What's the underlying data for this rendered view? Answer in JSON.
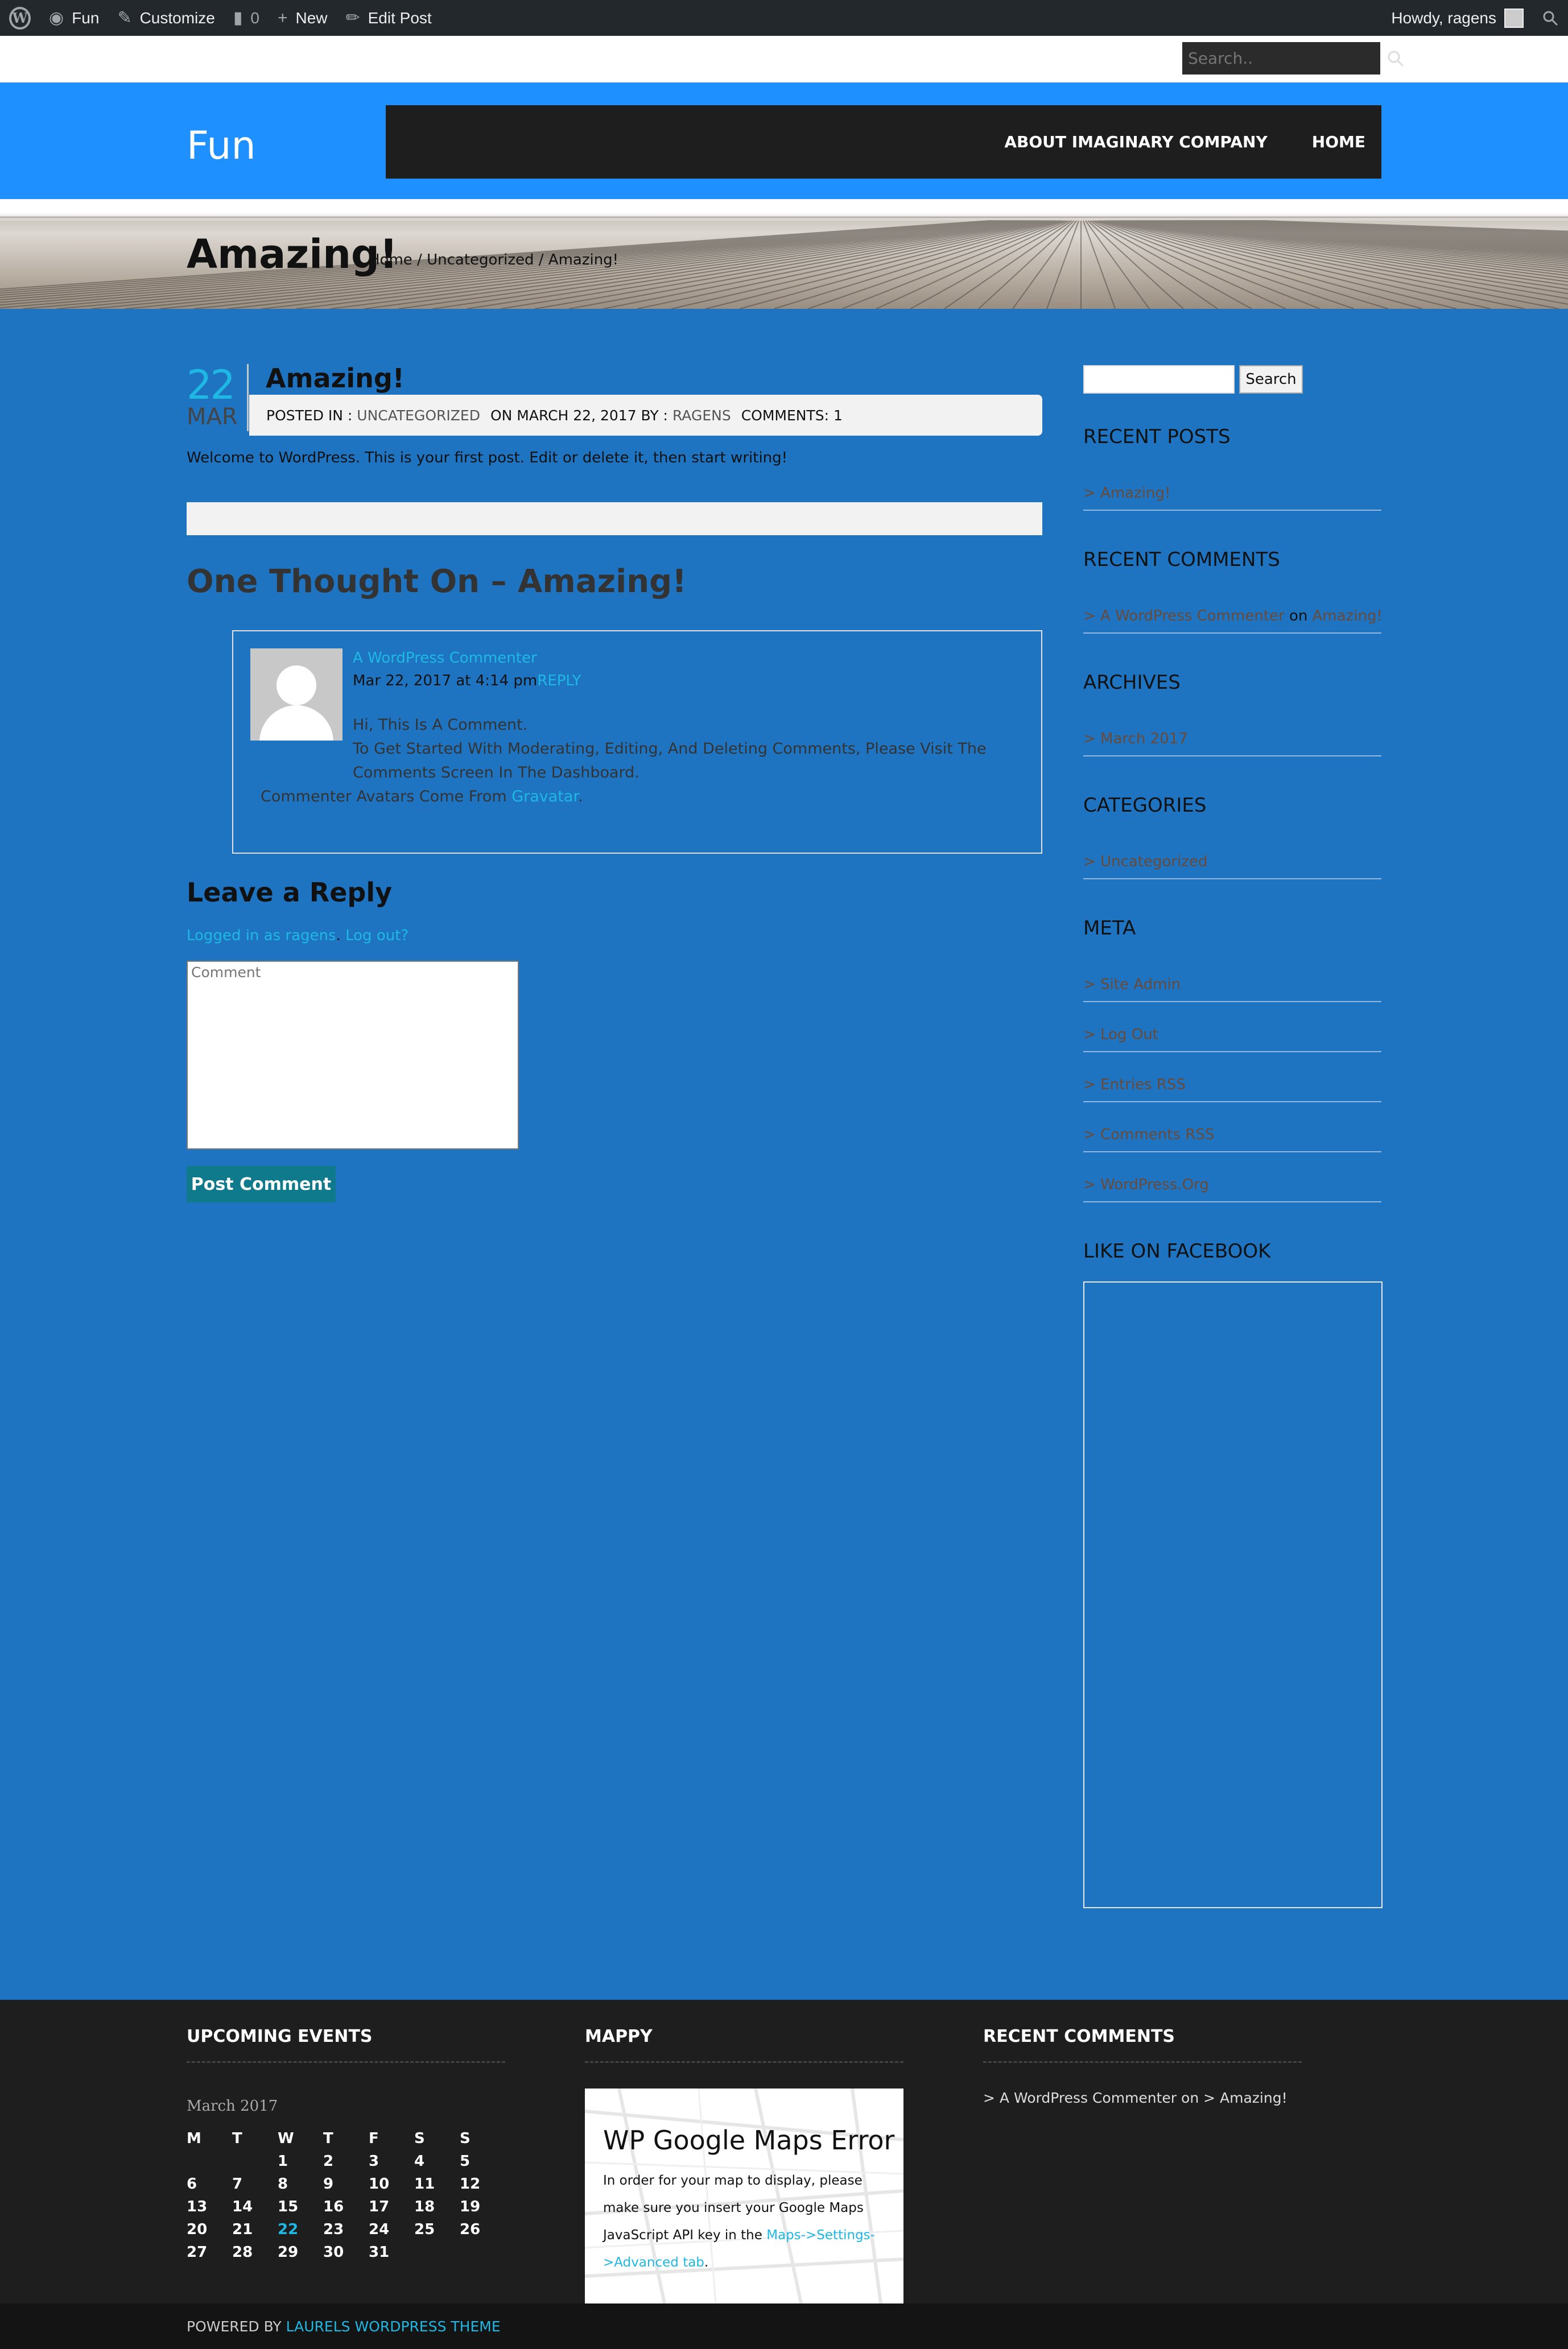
{
  "admin_bar": {
    "site": "Fun",
    "customize": "Customize",
    "comments_count": "0",
    "new": "New",
    "edit_post": "Edit Post",
    "howdy": "Howdy, ragens"
  },
  "top_search": {
    "placeholder": "Search.."
  },
  "header": {
    "site_title": "Fun",
    "nav": [
      "ABOUT IMAGINARY COMPANY",
      "HOME"
    ]
  },
  "banner": {
    "title": "Amazing!",
    "breadcrumb": [
      "Home",
      "Uncategorized",
      "Amazing!"
    ],
    "separator": " / "
  },
  "post": {
    "day": "22",
    "month": "MAR",
    "title": "Amazing!",
    "meta": {
      "posted_in_label": "POSTED IN :",
      "category": "UNCATEGORIZED",
      "on_label": "ON MARCH 22, 2017 BY :",
      "author": "RAGENS",
      "comments_label": "COMMENTS: 1"
    },
    "body": "Welcome to WordPress. This is your first post. Edit or delete it, then start writing!"
  },
  "comments": {
    "heading": "One Thought On – Amazing!",
    "items": [
      {
        "author": "A WordPress Commenter",
        "date": "Mar 22, 2017 at 4:14 pm",
        "reply": "REPLY",
        "line1": "Hi, This Is A Comment.",
        "line2": "To Get Started With Moderating, Editing, And Deleting Comments, Please Visit The Comments Screen In The Dashboard.",
        "line3_prefix": "Commenter Avatars Come From ",
        "line3_link": "Gravatar",
        "line3_suffix": "."
      }
    ]
  },
  "reply_form": {
    "heading": "Leave a Reply",
    "logged_in": "Logged in as ragens",
    "separator": ".",
    "logout": " Log out?",
    "comment_placeholder": "Comment",
    "submit": "Post Comment"
  },
  "sidebar": {
    "search_button": "Search",
    "recent_posts": {
      "title": "RECENT POSTS",
      "items": [
        "> Amazing!"
      ]
    },
    "recent_comments": {
      "title": "RECENT COMMENTS",
      "author": "> A WordPress Commenter",
      "on": " on ",
      "post": "Amazing!"
    },
    "archives": {
      "title": "ARCHIVES",
      "items": [
        "> March 2017"
      ]
    },
    "categories": {
      "title": "CATEGORIES",
      "items": [
        "> Uncategorized"
      ]
    },
    "meta": {
      "title": "META",
      "items": [
        "> Site Admin",
        "> Log Out",
        "> Entries RSS",
        "> Comments RSS",
        "> WordPress.Org"
      ]
    },
    "facebook": {
      "title": "LIKE ON FACEBOOK"
    }
  },
  "footer": {
    "events": {
      "title": "UPCOMING EVENTS",
      "caption": "March 2017",
      "headers": [
        "M",
        "T",
        "W",
        "T",
        "F",
        "S",
        "S"
      ],
      "weeks": [
        [
          "",
          "",
          "1",
          "2",
          "3",
          "4",
          "5"
        ],
        [
          "6",
          "7",
          "8",
          "9",
          "10",
          "11",
          "12"
        ],
        [
          "13",
          "14",
          "15",
          "16",
          "17",
          "18",
          "19"
        ],
        [
          "20",
          "21",
          "22",
          "23",
          "24",
          "25",
          "26"
        ],
        [
          "27",
          "28",
          "29",
          "30",
          "31",
          "",
          ""
        ]
      ],
      "today": "22"
    },
    "mappy": {
      "title": "MAPPY",
      "error_title": "WP Google Maps Error",
      "error_text": "In order for your map to display, please make sure you insert your Google Maps JavaScript API key in the ",
      "error_link": "Maps->Settings->Advanced tab",
      "error_end": "."
    },
    "recent_comments": {
      "title": "RECENT COMMENTS",
      "text": "> A WordPress Commenter on > Amazing!"
    },
    "powered_label": "POWERED BY ",
    "powered_link": "LAURELS WORDPRESS THEME"
  },
  "colors": {
    "body_bg": "#1f74c2",
    "header_bg": "#1e90ff",
    "nav_bg": "#1e1e1e",
    "accent": "#1eb8e4",
    "button": "#0e7a8c",
    "footer_bg": "#1e1e1e"
  }
}
